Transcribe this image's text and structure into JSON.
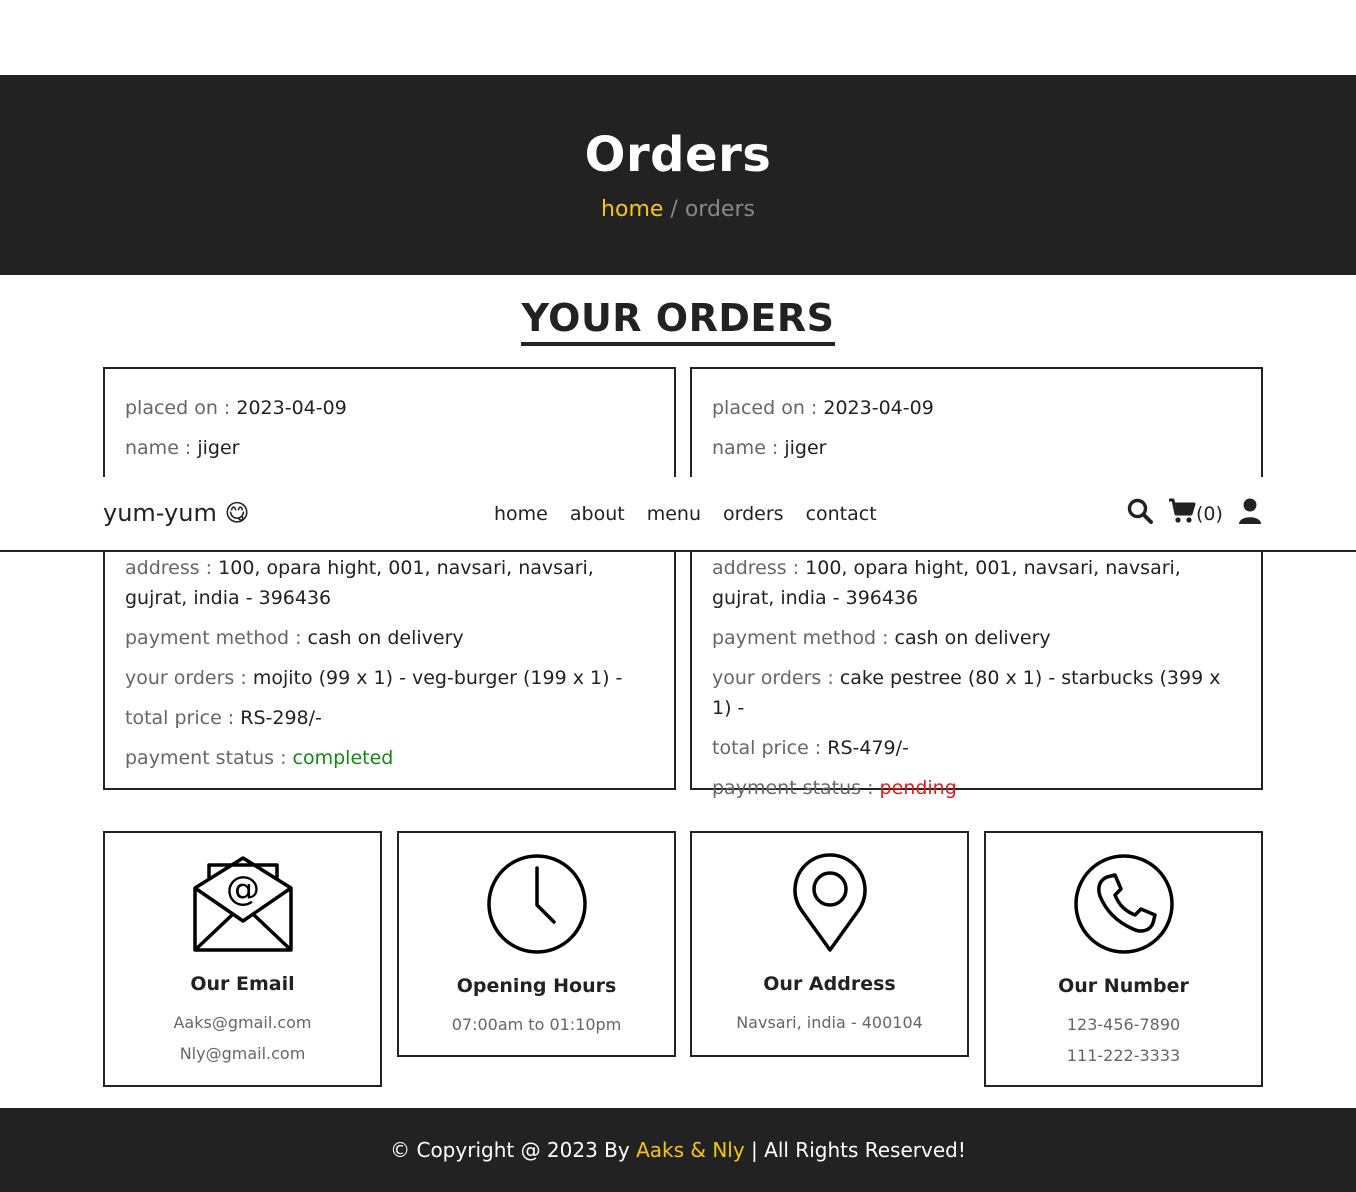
{
  "banner": {
    "title": "Orders",
    "breadcrumb_home": "home",
    "breadcrumb_sep": " / ",
    "breadcrumb_current": "orders"
  },
  "section_title": "YOUR ORDERS",
  "labels": {
    "placed_on": "placed on : ",
    "name": "name : ",
    "address": "address : ",
    "payment_method": "payment method : ",
    "your_orders": "your orders : ",
    "total_price": "total price : ",
    "payment_status": "payment status : "
  },
  "orders": [
    {
      "placed_on": "2023-04-09",
      "name": "jiger",
      "address": "100, opara hight, 001, navsari, navsari, gujrat, india - 396436",
      "payment_method": "cash on delivery",
      "items": "mojito (99 x 1) - veg-burger (199 x 1) -",
      "total_price": "RS-298/-",
      "payment_status": "completed",
      "status_color": "#118811"
    },
    {
      "placed_on": "2023-04-09",
      "name": "jiger",
      "address": "100, opara hight, 001, navsari, navsari, gujrat, india - 396436",
      "payment_method": "cash on delivery",
      "items": "cake pestree (80 x 1) - starbucks (399 x 1) -",
      "total_price": "RS-479/-",
      "payment_status": "pending",
      "status_color": "#e01b1b"
    }
  ],
  "navbar": {
    "logo": "yum-yum",
    "logo_emoji": "😋",
    "links": [
      "home",
      "about",
      "menu",
      "orders",
      "contact"
    ],
    "cart_count": "(0)",
    "icons": [
      "search-icon",
      "cart-icon",
      "user-icon"
    ]
  },
  "info": [
    {
      "icon": "email-icon",
      "title": "Our Email",
      "lines": [
        "Aaks@gmail.com",
        "Nly@gmail.com"
      ]
    },
    {
      "icon": "clock-icon",
      "title": "Opening Hours",
      "lines": [
        "07:00am to 01:10pm"
      ]
    },
    {
      "icon": "location-pin-icon",
      "title": "Our Address",
      "lines": [
        "Navsari, india - 400104"
      ]
    },
    {
      "icon": "phone-icon",
      "title": "Our Number",
      "lines": [
        "123-456-7890",
        "111-222-3333"
      ]
    }
  ],
  "footer": {
    "prefix": "© Copyright @ 2023 By ",
    "brand": "Aaks & Nly",
    "suffix": " | All Rights Reserved!"
  },
  "colors": {
    "accent": "#f5c518",
    "dark": "#222222",
    "status_completed": "#118811",
    "status_pending": "#e01b1b"
  }
}
